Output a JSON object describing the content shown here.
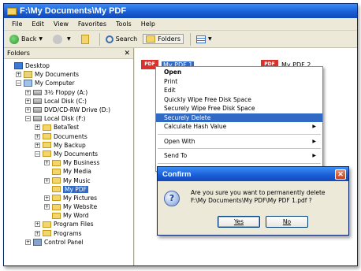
{
  "window": {
    "title": "F:\\My Documents\\My PDF"
  },
  "menubar": [
    "File",
    "Edit",
    "View",
    "Favorites",
    "Tools",
    "Help"
  ],
  "toolbar": {
    "back": "Back",
    "search": "Search",
    "folders": "Folders"
  },
  "folders_pane": {
    "header": "Folders",
    "close": "✕",
    "tree": [
      {
        "label": "Desktop",
        "icon": "desktop-icon",
        "indent": 0,
        "expander": ""
      },
      {
        "label": "My Documents",
        "icon": "my-documents-icon",
        "indent": 1,
        "expander": "+"
      },
      {
        "label": "My Computer",
        "icon": "my-computer-icon",
        "indent": 1,
        "expander": "−"
      },
      {
        "label": "3½ Floppy (A:)",
        "icon": "floppy-icon",
        "indent": 2,
        "expander": "+"
      },
      {
        "label": "Local Disk (C:)",
        "icon": "drive-icon",
        "indent": 2,
        "expander": "+"
      },
      {
        "label": "DVD/CD-RW Drive (D:)",
        "icon": "dvd-drive-icon",
        "indent": 2,
        "expander": "+"
      },
      {
        "label": "Local Disk (F:)",
        "icon": "drive-icon",
        "indent": 2,
        "expander": "−"
      },
      {
        "label": "BetaTest",
        "icon": "folder-icon",
        "indent": 3,
        "expander": "+"
      },
      {
        "label": "Documents",
        "icon": "folder-icon",
        "indent": 3,
        "expander": "+"
      },
      {
        "label": "My Backup",
        "icon": "folder-icon",
        "indent": 3,
        "expander": "+"
      },
      {
        "label": "My Documents",
        "icon": "folder-icon",
        "indent": 3,
        "expander": "−"
      },
      {
        "label": "My Business",
        "icon": "folder-icon",
        "indent": 4,
        "expander": "+"
      },
      {
        "label": "My Media",
        "icon": "folder-icon",
        "indent": 4,
        "expander": ""
      },
      {
        "label": "My Music",
        "icon": "folder-icon",
        "indent": 4,
        "expander": "+"
      },
      {
        "label": "My PDF",
        "icon": "folder-icon",
        "indent": 4,
        "expander": "",
        "selected": true
      },
      {
        "label": "My Pictures",
        "icon": "folder-icon",
        "indent": 4,
        "expander": "+"
      },
      {
        "label": "My Website",
        "icon": "folder-icon",
        "indent": 4,
        "expander": "+"
      },
      {
        "label": "My Word",
        "icon": "folder-icon",
        "indent": 4,
        "expander": ""
      },
      {
        "label": "Program Files",
        "icon": "folder-icon",
        "indent": 3,
        "expander": "+"
      },
      {
        "label": "Programs",
        "icon": "folder-icon",
        "indent": 3,
        "expander": "+"
      },
      {
        "label": "Control Panel",
        "icon": "control-panel-icon",
        "indent": 2,
        "expander": "+"
      }
    ]
  },
  "files": [
    {
      "name": "My PDF 1",
      "badge": "PDF"
    },
    {
      "name": "My PDF 2",
      "badge": "PDF"
    }
  ],
  "context_menu": {
    "items": [
      {
        "label": "Open",
        "bold": true
      },
      {
        "label": "Print"
      },
      {
        "label": "Edit"
      },
      {
        "label": "Quickly Wipe Free Disk Space"
      },
      {
        "label": "Securely Wipe Free Disk Space"
      },
      {
        "label": "Securely Delete",
        "highlight": true
      },
      {
        "label": "Calculate Hash Value",
        "submenu": true
      },
      {
        "separator": true
      },
      {
        "label": "Open With",
        "submenu": true
      },
      {
        "separator": true
      },
      {
        "label": "Send To",
        "submenu": true
      },
      {
        "separator": true
      }
    ]
  },
  "dialog": {
    "title": "Confirm",
    "message_line1": "Are you sure you want to permanently delete",
    "message_line2": "F:\\My Documents\\My PDF\\My PDF 1.pdf ?",
    "yes": "Yes",
    "no": "No"
  }
}
